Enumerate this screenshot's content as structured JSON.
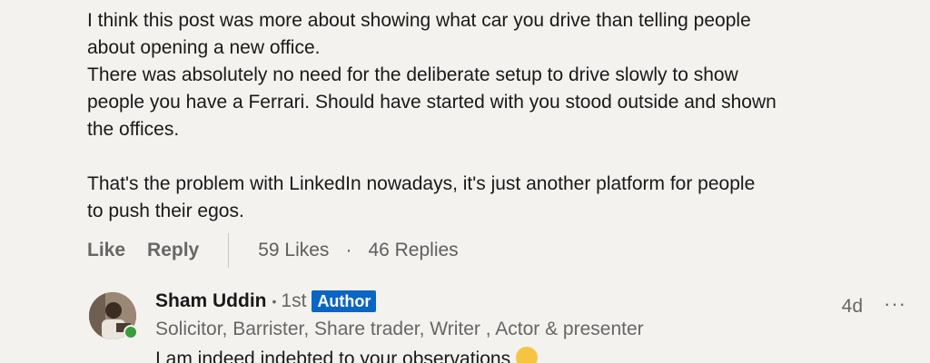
{
  "comment": {
    "lines_para1": [
      "I think this post was more about showing what car you drive than telling people",
      "about opening a new office.",
      "There was absolutely no need for the deliberate setup to drive slowly to show",
      "people you have a Ferrari. Should have started with you stood outside and shown",
      "the offices."
    ],
    "lines_para2": [
      "That's the problem with LinkedIn nowadays, it's just another platform for people",
      "to push their egos."
    ]
  },
  "actions": {
    "like_label": "Like",
    "reply_label": "Reply",
    "likes_count": "59 Likes",
    "separator": "·",
    "replies_count": "46 Replies"
  },
  "reply": {
    "author_name": "Sham Uddin",
    "bullet": "•",
    "degree": "1st",
    "badge": "Author",
    "headline": "Solicitor, Barrister, Share trader, Writer , Actor & presenter",
    "time": "4d",
    "more_icon": "···",
    "text": "I am indeed indebted to your observations",
    "emoji_icon": "relieved-face-emoji"
  },
  "colors": {
    "background": "#f3f2ef",
    "badge": "#0a66c2",
    "presence": "#3a9d3a"
  }
}
